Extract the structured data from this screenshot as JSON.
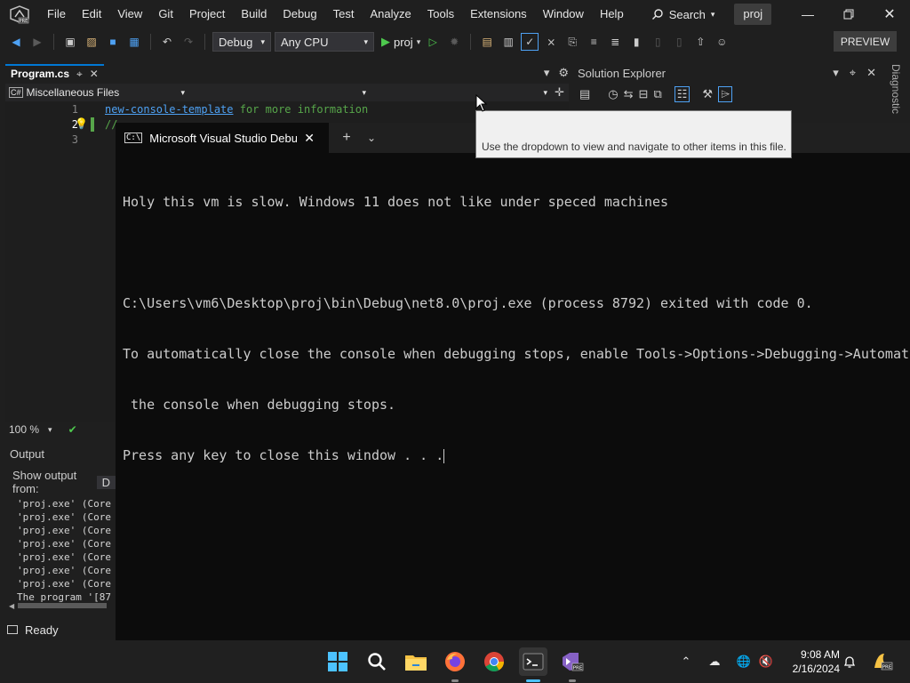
{
  "app": {
    "menu": [
      "File",
      "Edit",
      "View",
      "Git",
      "Project",
      "Build",
      "Debug",
      "Test",
      "Analyze",
      "Tools",
      "Extensions",
      "Window",
      "Help"
    ],
    "search_label": "Search",
    "project_name": "proj",
    "preview_label": "PREVIEW"
  },
  "toolbar": {
    "configuration": "Debug",
    "platform": "Any CPU",
    "run_target": "proj"
  },
  "editor": {
    "tab_label": "Program.cs",
    "nav_scope": "Miscellaneous Files",
    "lines": [
      "1",
      "2",
      "3"
    ],
    "line1_link": "new-console-template",
    "line1_rest": " for more information",
    "line2_text": "//",
    "zoom": "100 %"
  },
  "output": {
    "title": "Output",
    "show_from_label": "Show output from:",
    "show_from_value": "D",
    "lines": [
      "'proj.exe' (Core",
      "'proj.exe' (Core",
      "'proj.exe' (Core",
      "'proj.exe' (Core",
      "'proj.exe' (Core",
      "'proj.exe' (Core",
      "'proj.exe' (Core",
      "The program '[87"
    ]
  },
  "status": {
    "ready": "Ready"
  },
  "solution_explorer": {
    "title": "Solution Explorer",
    "side_label": "Diagnostic"
  },
  "tooltip": {
    "text": "Use the dropdown to view and navigate to other items in this file."
  },
  "terminal": {
    "tab_title": "Microsoft Visual Studio Debug Console",
    "lines": [
      "Holy this vm is slow. Windows 11 does not like under speced machines",
      "",
      "C:\\Users\\vm6\\Desktop\\proj\\bin\\Debug\\net8.0\\proj.exe (process 8792) exited with code 0.",
      "To automatically close the console when debugging stops, enable Tools->Options->Debugging->Automatically close",
      " the console when debugging stops.",
      "Press any key to close this window . . ."
    ]
  },
  "taskbar": {
    "time": "9:08 AM",
    "date": "2/16/2024",
    "apps": [
      "start-icon",
      "search-icon",
      "file-explorer-icon",
      "firefox-icon",
      "chrome-icon",
      "terminal-icon",
      "visual-studio-preview-icon"
    ]
  },
  "colors": {
    "accent": "#0078d4",
    "vs_purple": "#8661c5",
    "terminal_bg": "#0c0c0c"
  }
}
